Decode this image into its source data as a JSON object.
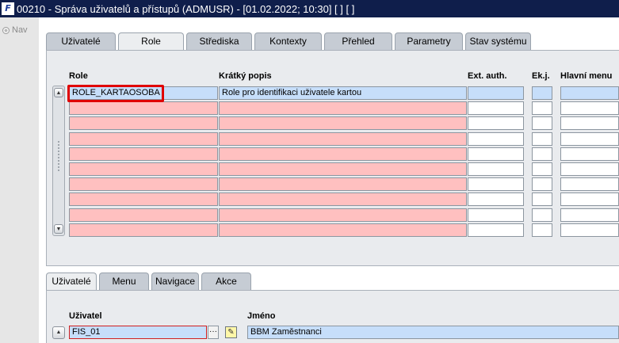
{
  "window": {
    "app_logo": "F",
    "title": "00210 - Správa uživatelů a přístupů (ADMUSR) - [01.02.2022; 10:30] [ ] [ ]"
  },
  "nav": {
    "label": "Nav"
  },
  "top_tabs": [
    {
      "label": "Uživatelé",
      "active": false
    },
    {
      "label": "Role",
      "active": true
    },
    {
      "label": "Střediska",
      "active": false
    },
    {
      "label": "Kontexty",
      "active": false
    },
    {
      "label": "Přehled",
      "active": false
    },
    {
      "label": "Parametry",
      "active": false
    },
    {
      "label": "Stav systému",
      "active": false
    }
  ],
  "roles_table": {
    "columns": {
      "role": "Role",
      "short_desc": "Krátký popis",
      "ext_auth": "Ext. auth.",
      "ek_j": "Ek.j.",
      "main_menu": "Hlavní menu"
    },
    "rows": [
      {
        "role": "ROLE_KARTAOSOBA",
        "short_desc": "Role pro identifikaci uživatele kartou",
        "ext_auth": "",
        "ek_j": "",
        "main_menu": ""
      },
      {
        "role": "",
        "short_desc": "",
        "ext_auth": "",
        "ek_j": "",
        "main_menu": ""
      },
      {
        "role": "",
        "short_desc": "",
        "ext_auth": "",
        "ek_j": "",
        "main_menu": ""
      },
      {
        "role": "",
        "short_desc": "",
        "ext_auth": "",
        "ek_j": "",
        "main_menu": ""
      },
      {
        "role": "",
        "short_desc": "",
        "ext_auth": "",
        "ek_j": "",
        "main_menu": ""
      },
      {
        "role": "",
        "short_desc": "",
        "ext_auth": "",
        "ek_j": "",
        "main_menu": ""
      },
      {
        "role": "",
        "short_desc": "",
        "ext_auth": "",
        "ek_j": "",
        "main_menu": ""
      },
      {
        "role": "",
        "short_desc": "",
        "ext_auth": "",
        "ek_j": "",
        "main_menu": ""
      },
      {
        "role": "",
        "short_desc": "",
        "ext_auth": "",
        "ek_j": "",
        "main_menu": ""
      },
      {
        "role": "",
        "short_desc": "",
        "ext_auth": "",
        "ek_j": "",
        "main_menu": ""
      }
    ]
  },
  "bottom_tabs": [
    {
      "label": "Uživatelé",
      "active": true
    },
    {
      "label": "Menu",
      "active": false
    },
    {
      "label": "Navigace",
      "active": false
    },
    {
      "label": "Akce",
      "active": false
    }
  ],
  "users_table": {
    "columns": {
      "user": "Uživatel",
      "name": "Jméno"
    },
    "rows": [
      {
        "user": "FIS_01",
        "name": "BBM Zaměstnanci"
      }
    ],
    "lov_button": "···",
    "edit_icon": "✎"
  },
  "scroll_icons": {
    "up": "▲",
    "down": "▼"
  },
  "colors": {
    "title_bar": "#0f1e4b",
    "required_field": "#ffc0c0",
    "current_record": "#c6defa",
    "focus_highlight": "#e00000"
  }
}
